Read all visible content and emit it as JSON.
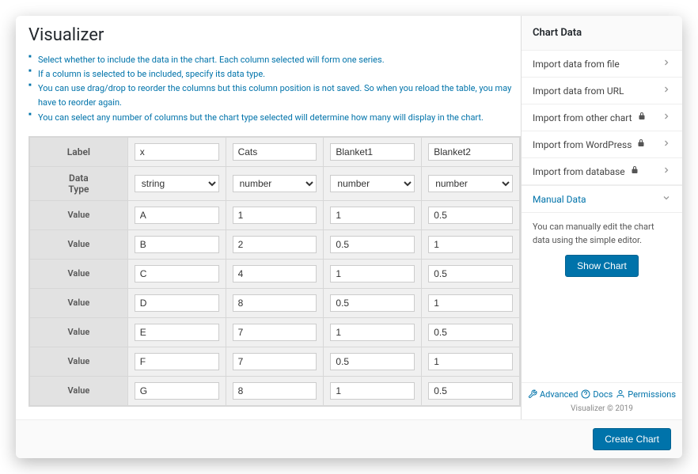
{
  "title": "Visualizer",
  "tips": [
    "Select whether to include the data in the chart. Each column selected will form one series.",
    "If a column is selected to be included, specify its data type.",
    "You can use drag/drop to reorder the columns but this column position is not saved. So when you reload the table, you may have to reorder again.",
    "You can select any number of columns but the chart type selected will determine how many will display in the chart."
  ],
  "table": {
    "label_head": "Label",
    "type_head": "Data Type",
    "value_head": "Value",
    "columns": [
      {
        "label": "x",
        "type": "string"
      },
      {
        "label": "Cats",
        "type": "number"
      },
      {
        "label": "Blanket1",
        "type": "number"
      },
      {
        "label": "Blanket2",
        "type": "number"
      }
    ],
    "rows": [
      [
        "A",
        "1",
        "1",
        "0.5"
      ],
      [
        "B",
        "2",
        "0.5",
        "1"
      ],
      [
        "C",
        "4",
        "1",
        "0.5"
      ],
      [
        "D",
        "8",
        "0.5",
        "1"
      ],
      [
        "E",
        "7",
        "1",
        "0.5"
      ],
      [
        "F",
        "7",
        "0.5",
        "1"
      ],
      [
        "G",
        "8",
        "1",
        "0.5"
      ]
    ]
  },
  "sidebar": {
    "title": "Chart Data",
    "items": [
      {
        "label": "Import data from file",
        "locked": false
      },
      {
        "label": "Import data from URL",
        "locked": false
      },
      {
        "label": "Import from other chart",
        "locked": true
      },
      {
        "label": "Import from WordPress",
        "locked": true
      },
      {
        "label": "Import from database",
        "locked": true
      }
    ],
    "active": {
      "label": "Manual Data"
    },
    "body": "You can manually edit the chart data using the simple editor.",
    "show_btn": "Show Chart"
  },
  "footer": {
    "advanced": "Advanced",
    "docs": "Docs",
    "permissions": "Permissions",
    "copyright": "Visualizer © 2019",
    "create": "Create Chart"
  }
}
